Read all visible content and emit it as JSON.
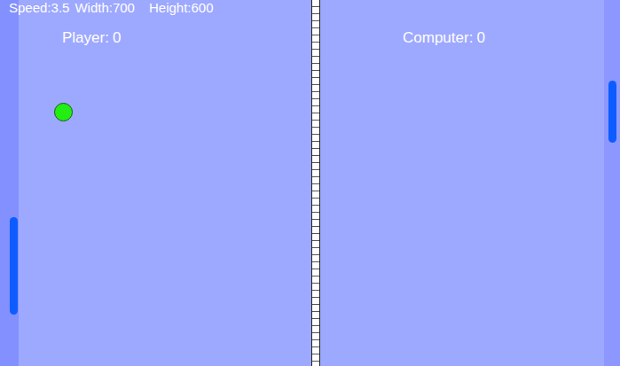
{
  "hud": [
    "Speed:3.5",
    "Width:700",
    "Height:600"
  ],
  "scores": [
    {
      "label": "Player:",
      "value": "0"
    },
    {
      "label": "Computer:",
      "value": "0"
    }
  ]
}
